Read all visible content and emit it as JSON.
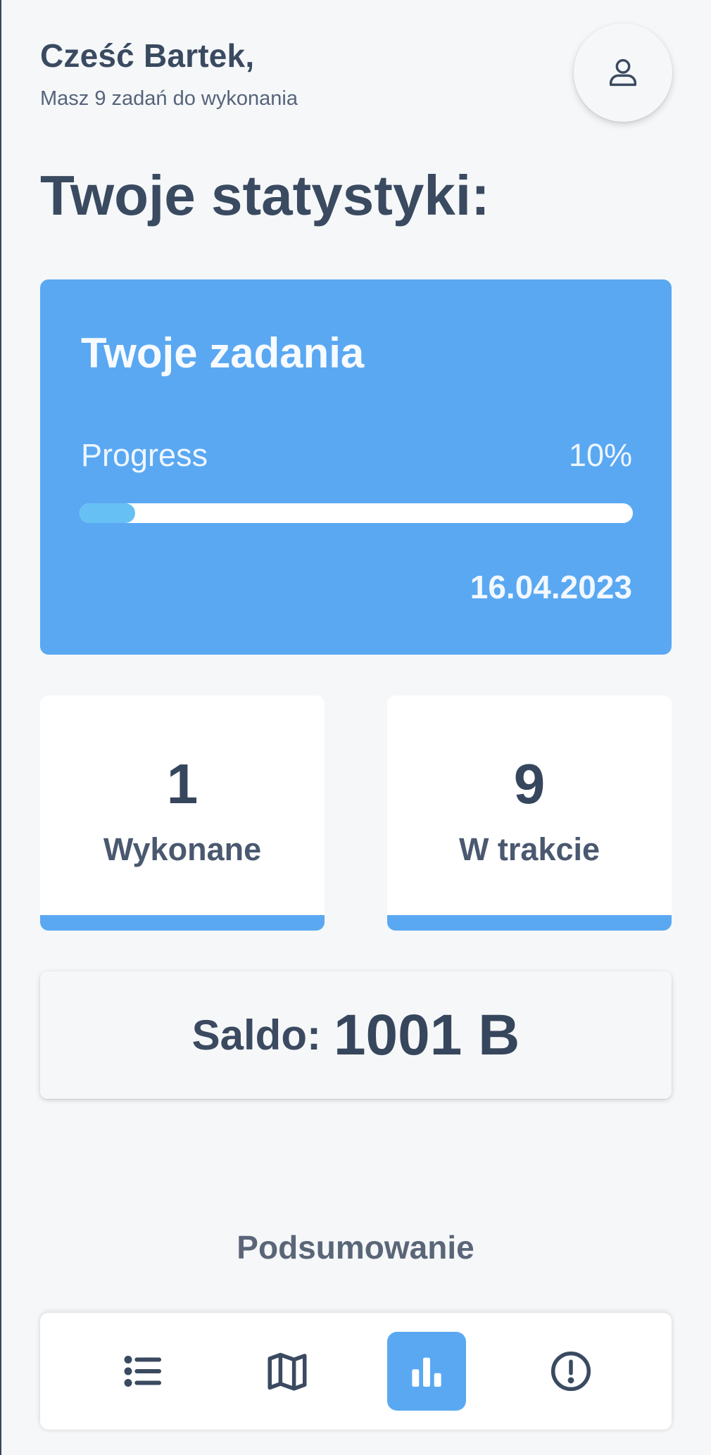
{
  "header": {
    "greeting": "Cześć Bartek,",
    "subtitle": "Masz 9 zadań do wykonania"
  },
  "profile_icon": "user-icon",
  "page_title": "Twoje statystyki:",
  "tasks_card": {
    "title": "Twoje zadania",
    "progress_label": "Progress",
    "progress_value_text": "10%",
    "progress_fraction": 0.1,
    "date": "16.04.2023"
  },
  "stats": [
    {
      "value": "1",
      "label": "Wykonane"
    },
    {
      "value": "9",
      "label": "W trakcie"
    }
  ],
  "saldo": {
    "label": "Saldo:",
    "value": "1001 B"
  },
  "section_label": "Podsumowanie",
  "bottom_nav": {
    "items": [
      {
        "icon": "list-icon",
        "active": false
      },
      {
        "icon": "map-icon",
        "active": false
      },
      {
        "icon": "bar-chart-icon",
        "active": true
      },
      {
        "icon": "alert-circle-icon",
        "active": false
      }
    ]
  },
  "colors": {
    "accent": "#5aa8f2",
    "progress_fill": "#66c0f4",
    "background": "#f5f7f9",
    "text_dark": "#3a4a60"
  }
}
